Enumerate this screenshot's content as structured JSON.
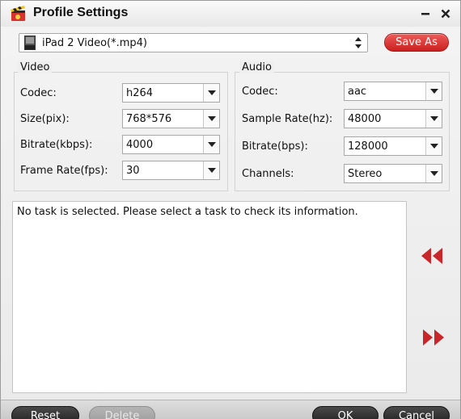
{
  "window": {
    "title": "Profile Settings",
    "icons": {
      "app": "film-clapper-icon",
      "minimize": "minimize-icon",
      "close": "close-icon"
    }
  },
  "profile": {
    "icon": "mp4-file-icon",
    "value": "iPad 2 Video(*.mp4)",
    "save_as_label": "Save As",
    "accent_color": "#d62a28"
  },
  "video": {
    "group_title": "Video",
    "fields": [
      {
        "label": "Codec:",
        "value": "h264"
      },
      {
        "label": "Size(pix):",
        "value": "768*576"
      },
      {
        "label": "Bitrate(kbps):",
        "value": "4000"
      },
      {
        "label": "Frame Rate(fps):",
        "value": "30"
      }
    ]
  },
  "audio": {
    "group_title": "Audio",
    "fields": [
      {
        "label": "Codec:",
        "value": "aac"
      },
      {
        "label": "Sample Rate(hz):",
        "value": "48000"
      },
      {
        "label": "Bitrate(bps):",
        "value": "128000"
      },
      {
        "label": "Channels:",
        "value": "Stereo"
      }
    ]
  },
  "info": {
    "message": "No task is selected. Please select a task to check its information.",
    "collapse_icon": "double-left-arrow-icon",
    "expand_icon": "double-right-arrow-icon",
    "arrow_color": "#c8262a"
  },
  "buttons": {
    "reset": "Reset",
    "delete": "Delete",
    "ok": "OK",
    "cancel": "Cancel"
  }
}
